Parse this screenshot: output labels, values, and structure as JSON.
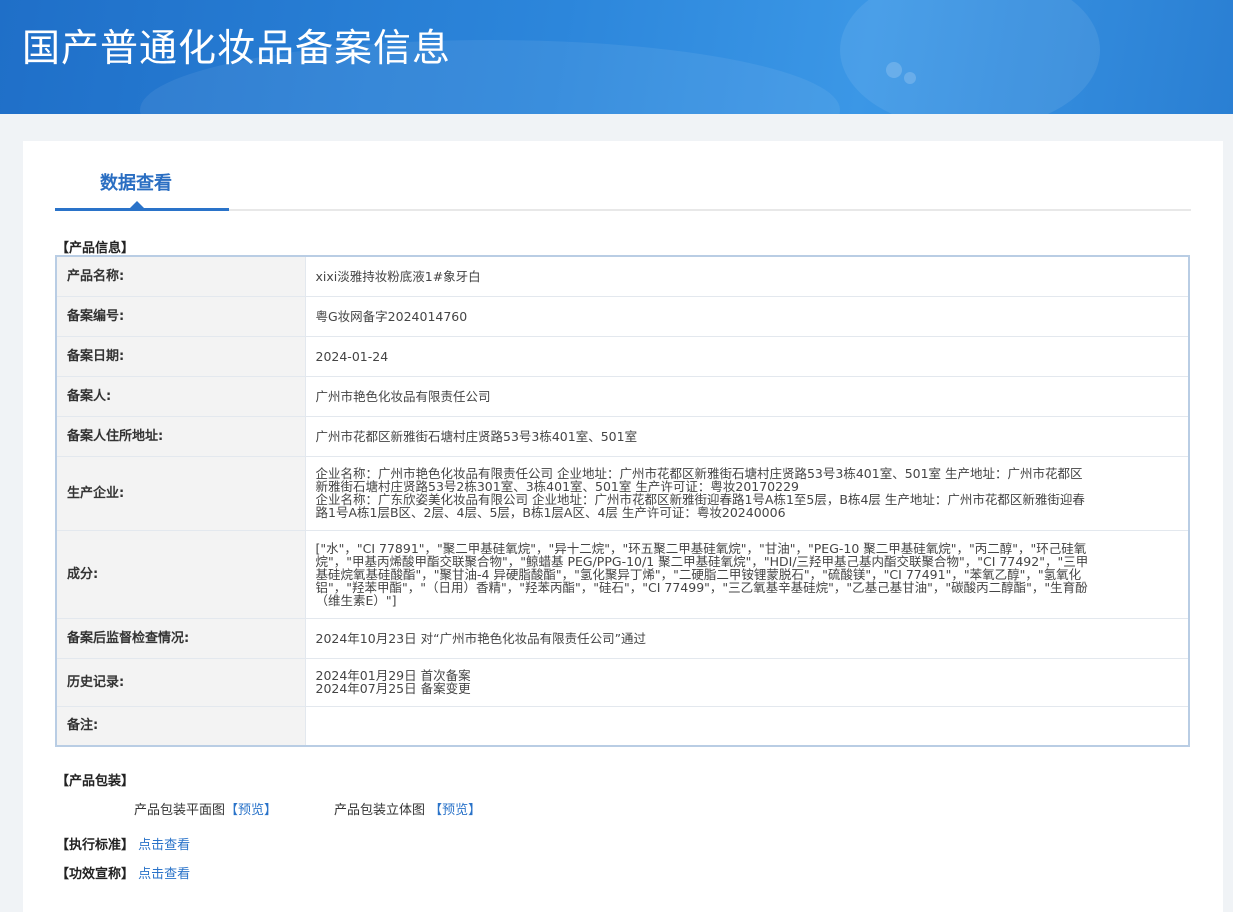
{
  "header": {
    "title": "国产普通化妆品备案信息"
  },
  "tabs": [
    {
      "label": "数据查看"
    }
  ],
  "product_info": {
    "section_label": "【产品信息】",
    "rows": [
      {
        "label": "产品名称:",
        "value": "xixi淡雅持妆粉底液1#象牙白"
      },
      {
        "label": "备案编号:",
        "value": "粤G妆网备字2024014760"
      },
      {
        "label": "备案日期:",
        "value": "2024-01-24"
      },
      {
        "label": "备案人:",
        "value": "广州市艳色化妆品有限责任公司"
      },
      {
        "label": "备案人住所地址:",
        "value": "广州市花都区新雅街石塘村庄贤路53号3栋401室、501室"
      },
      {
        "label": "生产企业:",
        "lines": [
          "企业名称：广州市艳色化妆品有限责任公司 企业地址：广州市花都区新雅街石塘村庄贤路53号3栋401室、501室 生产地址：广州市花都区",
          "新雅街石塘村庄贤路53号2栋301室、3栋401室、501室 生产许可证：粤妆20170229",
          "企业名称：广东欣姿美化妆品有限公司 企业地址：广州市花都区新雅街迎春路1号A栋1至5层，B栋4层 生产地址：广州市花都区新雅街迎春",
          "路1号A栋1层B区、2层、4层、5层，B栋1层A区、4层 生产许可证：粤妆20240006"
        ]
      },
      {
        "label": "成分:",
        "lines": [
          "[\"水\"，\"CI 77891\"，\"聚二甲基硅氧烷\"，\"异十二烷\"，\"环五聚二甲基硅氧烷\"，\"甘油\"，\"PEG-10 聚二甲基硅氧烷\"，\"丙二醇\"，\"环己硅氧",
          "烷\"，\"甲基丙烯酸甲酯交联聚合物\"，\"鲸蜡基 PEG/PPG-10/1 聚二甲基硅氧烷\"，\"HDI/三羟甲基己基内酯交联聚合物\"，\"CI 77492\"，\"三甲",
          "基硅烷氧基硅酸酯\"，\"聚甘油-4 异硬脂酸酯\"，\"氢化聚异丁烯\"，\"二硬脂二甲铵锂蒙脱石\"，\"硫酸镁\"，\"CI 77491\"，\"苯氧乙醇\"，\"氢氧化",
          "铝\"，\"羟苯甲酯\"，\"（日用）香精\"，\"羟苯丙酯\"，\"硅石\"，\"CI 77499\"，\"三乙氧基辛基硅烷\"，\"乙基己基甘油\"，\"碳酸丙二醇酯\"，\"生育酚",
          "（维生素E）\"]"
        ]
      },
      {
        "label": "备案后监督检查情况:",
        "value": "2024年10月23日 对“广州市艳色化妆品有限责任公司”通过"
      },
      {
        "label": "历史记录:",
        "lines": [
          "2024年01月29日 首次备案",
          "2024年07月25日 备案变更"
        ]
      },
      {
        "label": "备注:",
        "value": ""
      }
    ]
  },
  "packaging": {
    "section_label": "【产品包装】",
    "flat_label": "产品包装平面图",
    "flat_preview": "【预览】",
    "solid_label": "产品包装立体图",
    "solid_preview": "【预览】"
  },
  "standard": {
    "label": "【执行标准】",
    "link": "点击查看"
  },
  "efficacy": {
    "label": "【功效宣称】",
    "link": "点击查看"
  }
}
